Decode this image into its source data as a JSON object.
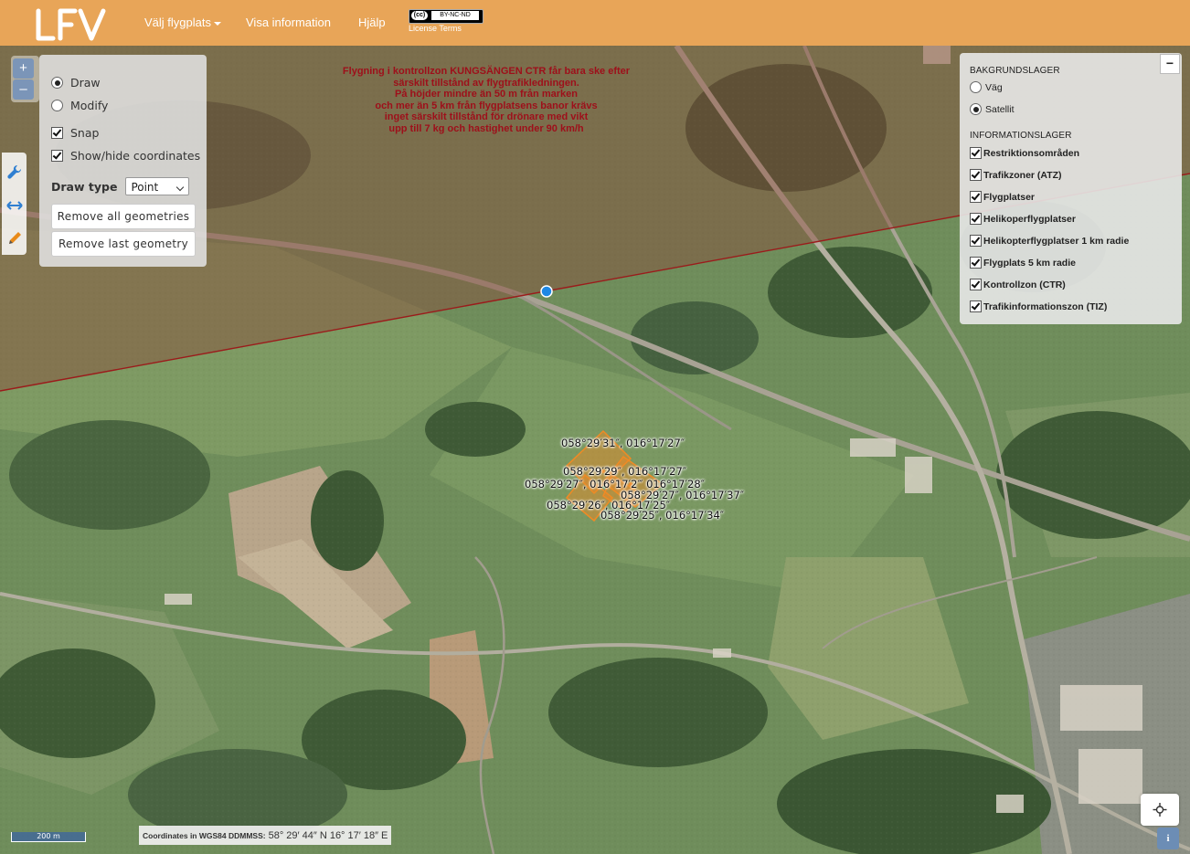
{
  "header": {
    "logo_text": "LFV",
    "nav": [
      {
        "label": "Välj flygplats",
        "has_caret": true
      },
      {
        "label": "Visa information",
        "has_caret": false
      },
      {
        "label": "Hjälp",
        "has_caret": false
      }
    ],
    "license_badge": {
      "cc": "(cc)",
      "label": "BY-NC-ND"
    },
    "license_text": "License Terms"
  },
  "map": {
    "restriction_text": [
      "Flygning i kontrollzon  KUNGSÄNGEN CTR får bara ske efter",
      "särskilt tillstånd av flygtrafikledningen.",
      "På höjder mindre än 50 m från marken",
      "och mer än 5 km från flygplatsens banor krävs",
      "inget särskilt tillstånd för drönare med vikt",
      "upp till 7 kg och hastighet under 90 km/h"
    ],
    "coordinate_labels": [
      "058°29′31″, 016°17′27″",
      "058°29′29″, 016°17′27″",
      "058°29′27″, 016°17′2‴ 016°17′28″",
      "058°29′27″, 016°17′37″",
      "058°29′26″, 016°17′25″",
      "058°29′25″, 016°17′34″"
    ],
    "colors": {
      "restricted_zone_tint": "#8a4a3a",
      "boundary_line": "#9b1b1b",
      "drawn_geometry": "#f08a24",
      "vertex_marker": "#1e88e5"
    }
  },
  "zoom": {
    "in": "+",
    "out": "–"
  },
  "tools": [
    "wrench-icon",
    "measure-icon",
    "pencil-icon"
  ],
  "draw_panel": {
    "mode_options": [
      {
        "label": "Draw",
        "selected": true
      },
      {
        "label": "Modify",
        "selected": false
      }
    ],
    "checkboxes": [
      {
        "label": "Snap",
        "checked": true
      },
      {
        "label": "Show/hide coordinates",
        "checked": true
      }
    ],
    "draw_type_label": "Draw type",
    "draw_type_value": "Point",
    "remove_all_label": "Remove all geometries",
    "remove_last_label": "Remove last geometry"
  },
  "layer_panel": {
    "collapse_label": "−",
    "background_heading": "BAKGRUNDSLAGER",
    "background_layers": [
      {
        "label": "Väg",
        "selected": false
      },
      {
        "label": "Satellit",
        "selected": true
      }
    ],
    "info_heading": "INFORMATIONSLAGER",
    "info_layers": [
      {
        "label": "Restriktionsområden",
        "checked": true
      },
      {
        "label": "Trafikzoner (ATZ)",
        "checked": true
      },
      {
        "label": "Flygplatser",
        "checked": true
      },
      {
        "label": "Helikoperflygplatser",
        "checked": true
      },
      {
        "label": "Helikopterflygplatser 1 km radie",
        "checked": true
      },
      {
        "label": "Flygplats 5 km radie",
        "checked": true
      },
      {
        "label": "Kontrollzon (CTR)",
        "checked": true
      },
      {
        "label": "Trafikinformationszon (TIZ)",
        "checked": true
      }
    ]
  },
  "footer": {
    "scale_label": "200 m",
    "coords_label": "Coordinates in WGS84 DDMMSS:",
    "coords_value": "58° 29′ 44″ N 16° 17′ 18″ E",
    "info_label": "i"
  }
}
